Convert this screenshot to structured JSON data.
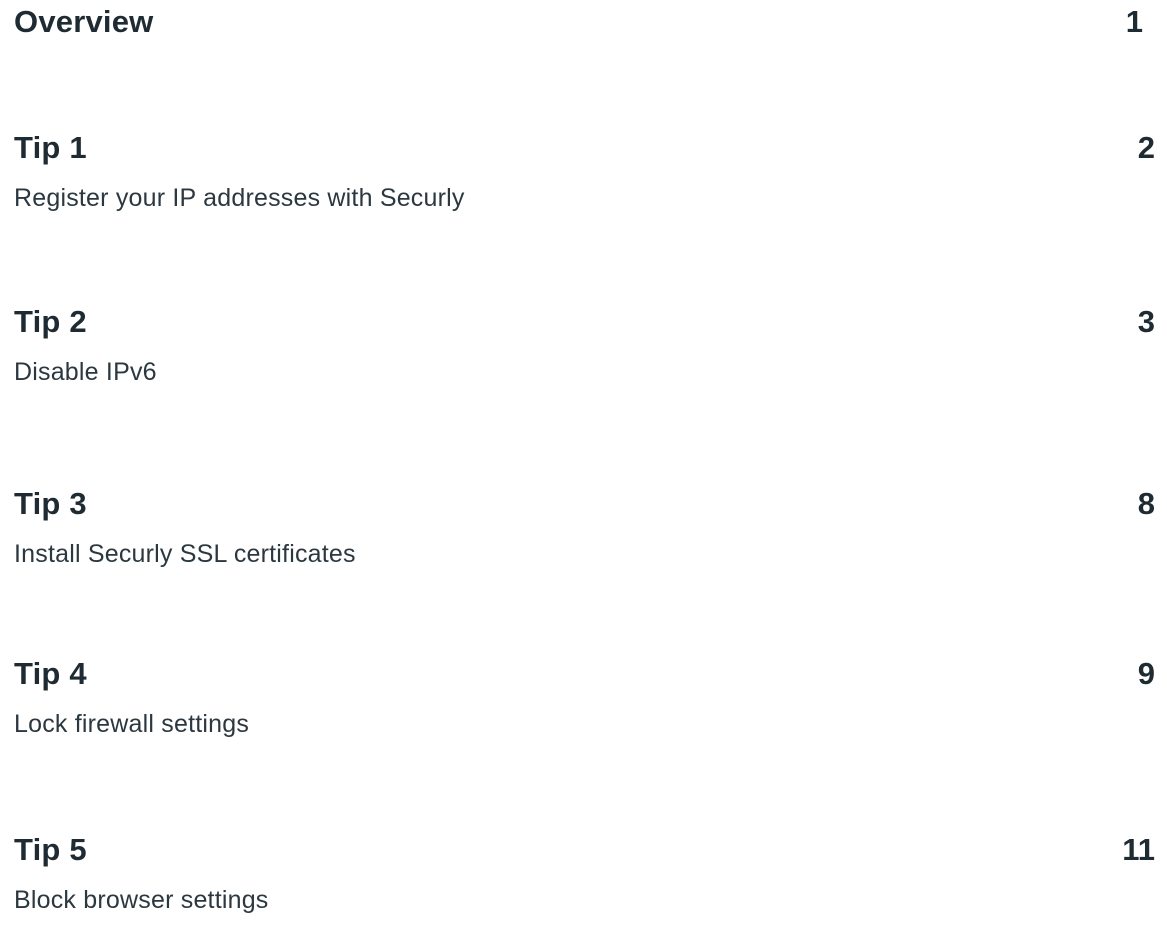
{
  "toc": {
    "entries": [
      {
        "title": "Overview",
        "page": "1",
        "description": ""
      },
      {
        "title": "Tip 1",
        "page": "2",
        "description": "Register your IP addresses with Securly"
      },
      {
        "title": "Tip 2",
        "page": "3",
        "description": "Disable IPv6"
      },
      {
        "title": "Tip 3",
        "page": "8",
        "description": "Install Securly SSL certificates"
      },
      {
        "title": "Tip 4",
        "page": "9",
        "description": "Lock firewall settings"
      },
      {
        "title": "Tip 5",
        "page": "11",
        "description": "Block browser settings"
      }
    ]
  }
}
